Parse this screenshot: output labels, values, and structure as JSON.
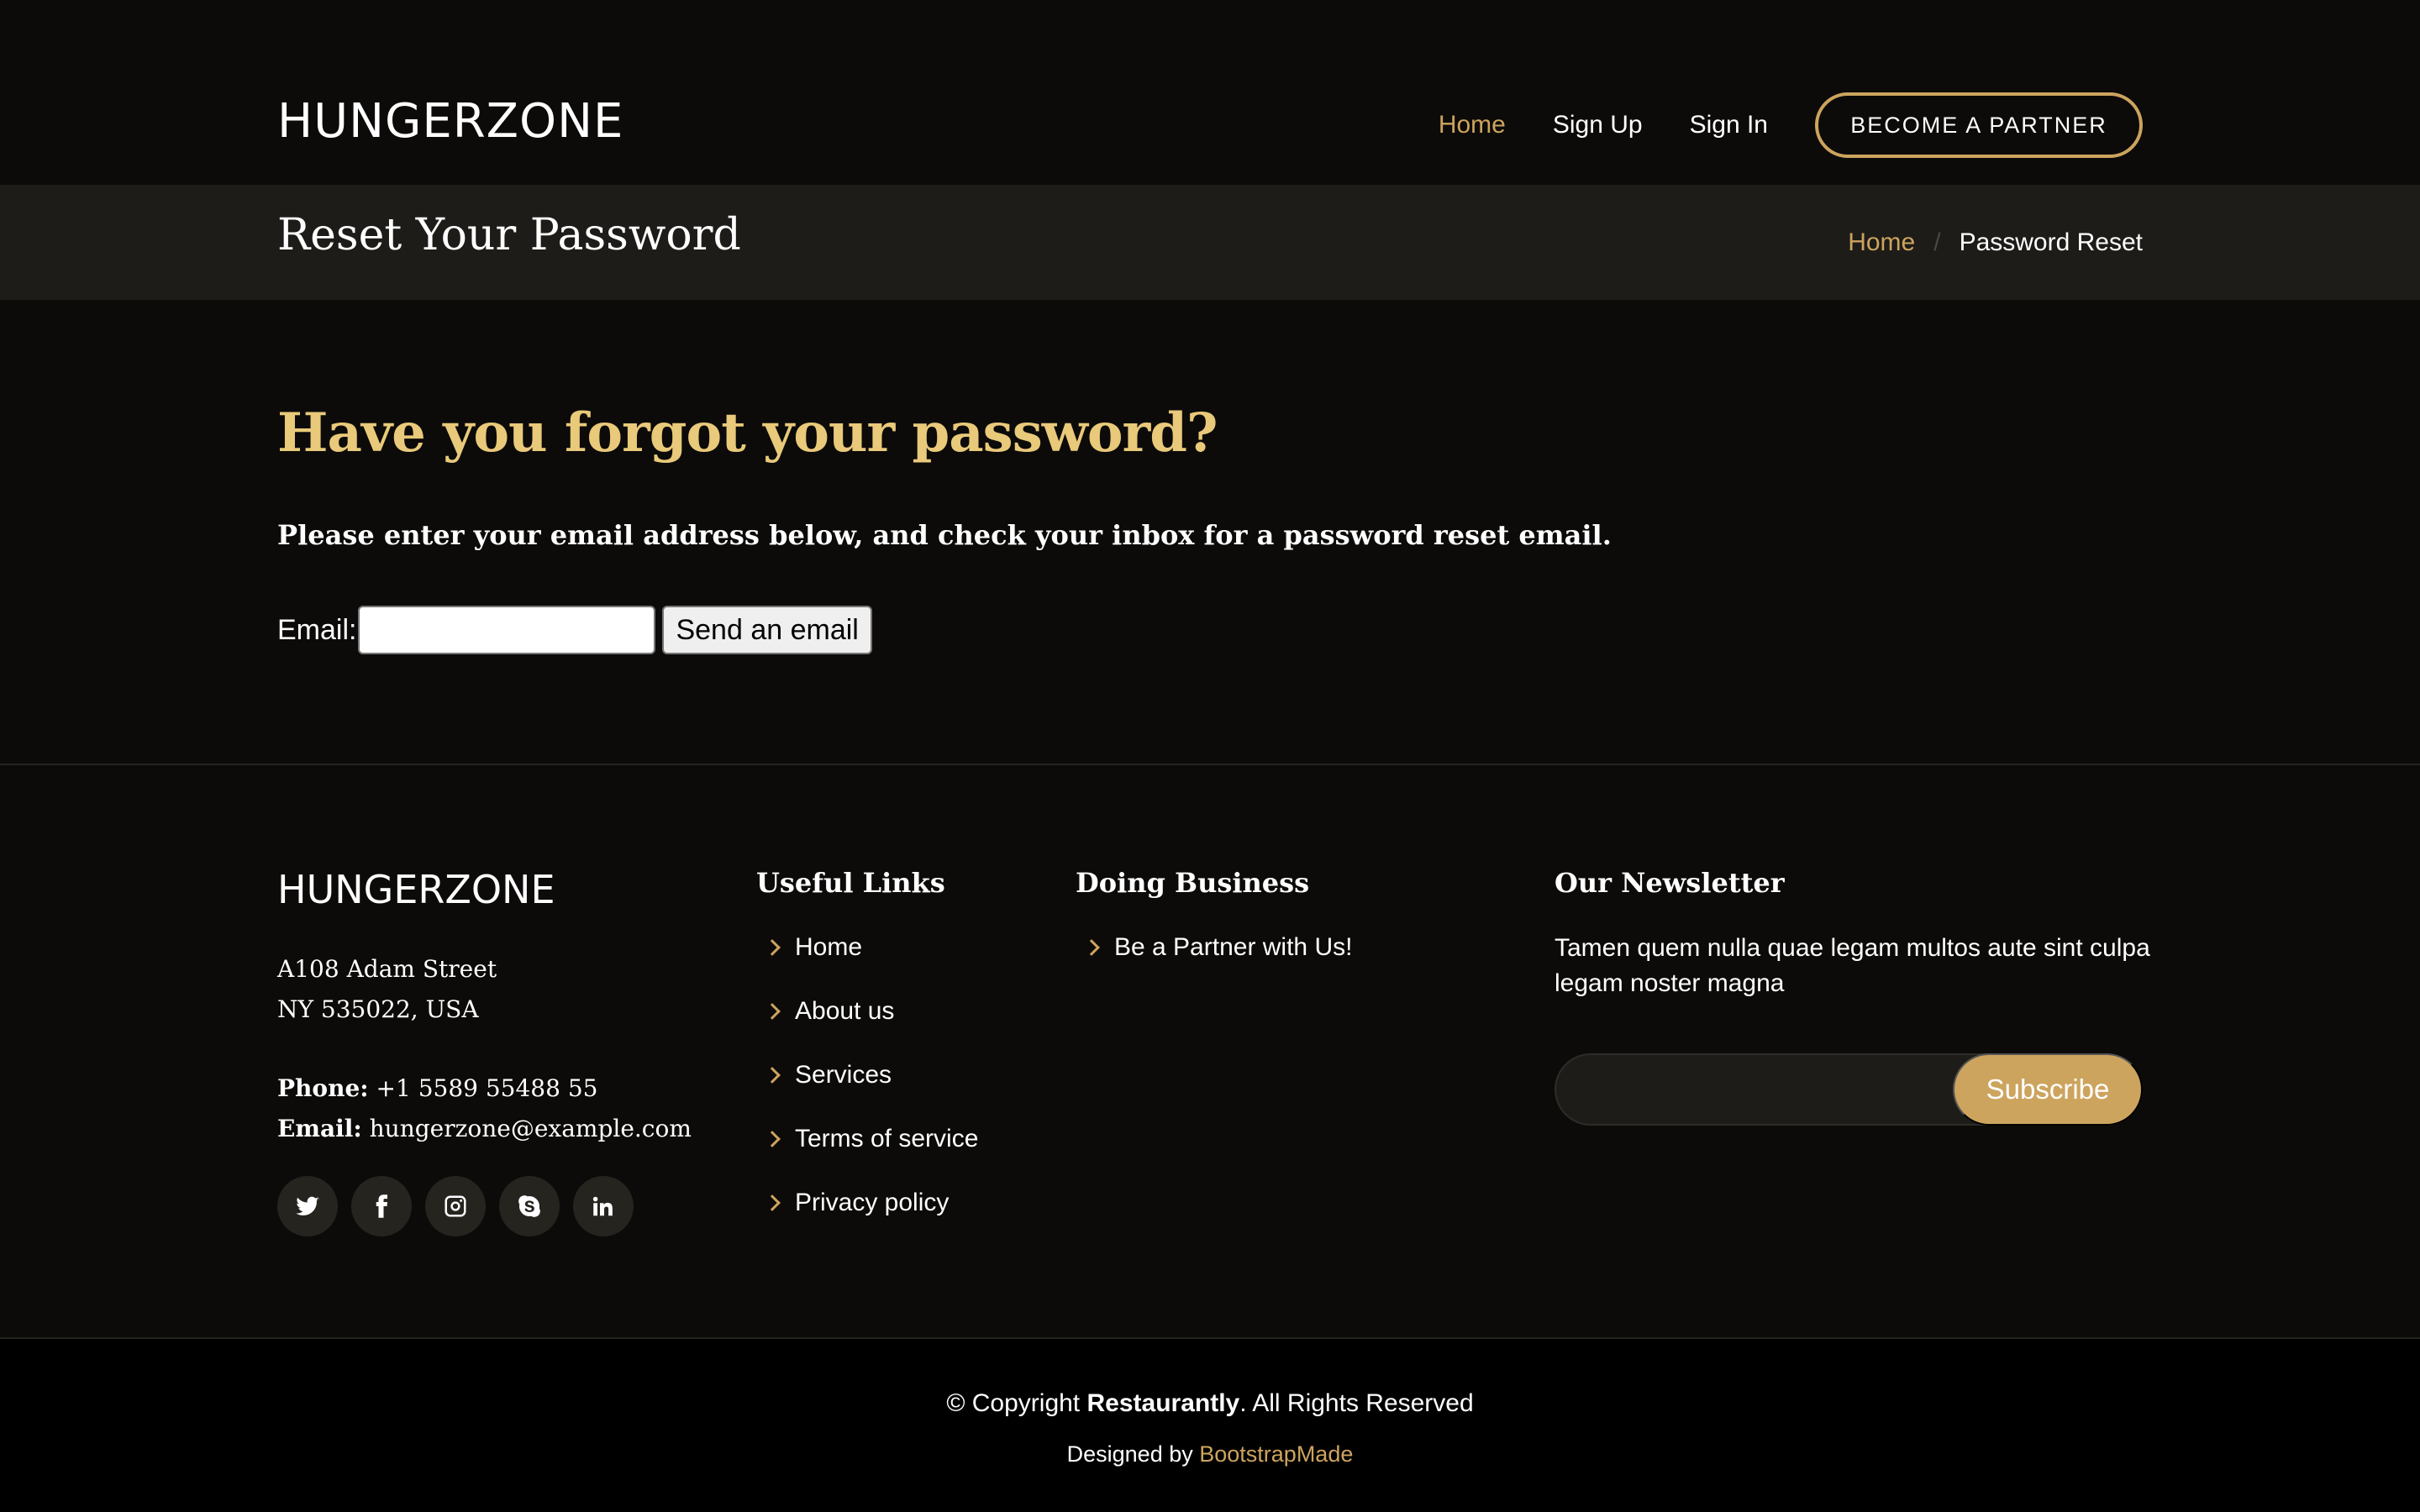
{
  "header": {
    "logo": "HUNGERZONE",
    "nav": [
      {
        "label": "Home",
        "active": true
      },
      {
        "label": "Sign Up",
        "active": false
      },
      {
        "label": "Sign In",
        "active": false
      }
    ],
    "partner_button": "BECOME A PARTNER"
  },
  "breadcrumbs": {
    "title": "Reset Your Password",
    "home": "Home",
    "separator": "/",
    "current": "Password Reset"
  },
  "main": {
    "heading": "Have you forgot your password?",
    "description": "Please enter your email address below, and check your inbox for a password reset email.",
    "email_label": "Email:",
    "email_value": "",
    "send_button": "Send an email"
  },
  "footer": {
    "logo": "HUNGERZONE",
    "address_line1": "A108 Adam Street",
    "address_line2": "NY 535022, USA",
    "phone_label": "Phone:",
    "phone": "+1 5589 55488 55",
    "email_label": "Email:",
    "email": "hungerzone@example.com",
    "socials": [
      "twitter-icon",
      "facebook-icon",
      "instagram-icon",
      "skype-icon",
      "linkedin-icon"
    ],
    "useful_links": {
      "title": "Useful Links",
      "items": [
        "Home",
        "About us",
        "Services",
        "Terms of service",
        "Privacy policy"
      ]
    },
    "doing_business": {
      "title": "Doing Business",
      "items": [
        "Be a Partner with Us!"
      ]
    },
    "newsletter": {
      "title": "Our Newsletter",
      "text": "Tamen quem nulla quae legam multos aute sint culpa legam noster magna",
      "input_value": "",
      "button": "Subscribe"
    },
    "copyright_prefix": "© Copyright ",
    "copyright_brand": "Restaurantly",
    "copyright_suffix": ". All Rights Reserved",
    "credits_prefix": "Designed by ",
    "credits_link": "BootstrapMade"
  },
  "colors": {
    "background": "#0c0b09",
    "accent": "#cda45e",
    "heading": "#e9c97a",
    "bar": "#1d1c19"
  }
}
